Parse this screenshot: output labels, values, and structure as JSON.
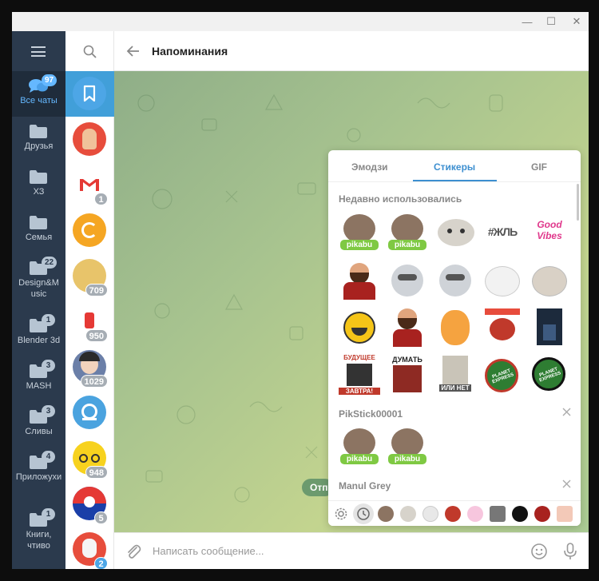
{
  "window": {
    "minimize": "—",
    "maximize": "☐",
    "close": "✕"
  },
  "folders": [
    {
      "label": "Все чаты",
      "badge": "97",
      "icon": "chat-bubbles-icon"
    },
    {
      "label": "Друзья",
      "badge": "",
      "icon": "folder-icon"
    },
    {
      "label": "ХЗ",
      "badge": "",
      "icon": "folder-icon"
    },
    {
      "label": "Семья",
      "badge": "",
      "icon": "folder-icon"
    },
    {
      "label": "Design&Music",
      "badge": "22",
      "icon": "folder-icon"
    },
    {
      "label": "Blender 3d",
      "badge": "1",
      "icon": "folder-icon"
    },
    {
      "label": "MASH",
      "badge": "3",
      "icon": "folder-icon"
    },
    {
      "label": "Сливы",
      "badge": "3",
      "icon": "folder-icon"
    },
    {
      "label": "Приложухи",
      "badge": "4",
      "icon": "folder-icon"
    },
    {
      "label": "Книги, чтиво",
      "badge": "1",
      "icon": "folder-icon"
    }
  ],
  "chats": [
    {
      "badge": ""
    },
    {
      "badge": ""
    },
    {
      "badge": "1"
    },
    {
      "badge": ""
    },
    {
      "badge": "709"
    },
    {
      "badge": "950"
    },
    {
      "badge": "1029"
    },
    {
      "badge": ""
    },
    {
      "badge": "948"
    },
    {
      "badge": "5"
    },
    {
      "badge": "2"
    }
  ],
  "header": {
    "title": "Напоминания"
  },
  "composer": {
    "placeholder": "Написать сообщение..."
  },
  "bubble": {
    "text": "Отп"
  },
  "panel": {
    "tabs": [
      "Эмодзи",
      "Стикеры",
      "GIF"
    ],
    "active_tab": "Стикеры",
    "sections": [
      {
        "title": "Недавно использовались"
      },
      {
        "title": "PikStick00001"
      },
      {
        "title": "Manul Grey"
      }
    ],
    "sticker_texts": {
      "pikabu": "pikabu",
      "zhzhl": "#ЖЛЬ",
      "good_vibes": "Good Vibes",
      "budushee": "БУДУЩЕЕ",
      "zavtra": "ЗАВТРА!",
      "dumat": "ДУМАТЬ",
      "ili_net": "ИЛИ НЕТ",
      "planet_express": "PLANET EXPRESS"
    }
  },
  "colors": {
    "accent": "#419fd9",
    "sidebar": "#2b3a4d",
    "active_folder": "#65b8ff"
  }
}
